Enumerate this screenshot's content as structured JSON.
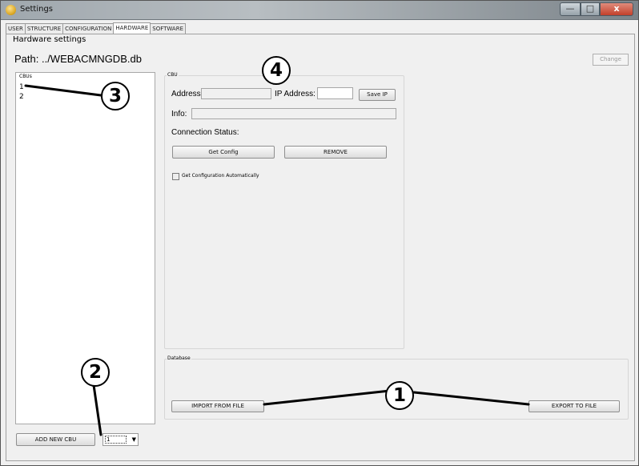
{
  "window": {
    "title": "Settings",
    "close_glyph": "x",
    "minimize_glyph": "—",
    "maximize_glyph": "□"
  },
  "tabs": [
    {
      "label": "USER"
    },
    {
      "label": "STRUCTURE"
    },
    {
      "label": "CONFIGURATION"
    },
    {
      "label": "HARDWARE",
      "active": true
    },
    {
      "label": "SOFTWARE"
    }
  ],
  "hardware": {
    "section_title": "Hardware settings",
    "path_label": "Path:  ../WEBACMNGDB.db",
    "change_label": "Change"
  },
  "cbu_list": {
    "header": "CBUs",
    "items": [
      "1",
      "2"
    ]
  },
  "cbu_panel": {
    "group_title": "CBU",
    "address_label": "Address:",
    "address_value": "",
    "ip_label": "IP Address:",
    "ip_value": "",
    "save_ip_label": "Save IP",
    "info_label": "Info:",
    "info_value": "",
    "connection_status_label": "Connection Status:",
    "get_config_label": "Get Config",
    "remove_label": "REMOVE",
    "auto_config_label": "Get Configuration Automatically",
    "auto_config_checked": false
  },
  "database": {
    "group_title": "Database",
    "import_label": "IMPORT FROM FILE",
    "export_label": "EXPORT TO FILE"
  },
  "bottom": {
    "add_new_cbu_label": "ADD NEW CBU",
    "cbu_count_value": "1",
    "dropdown_glyph": "▼"
  },
  "annotations": [
    "1",
    "2",
    "3",
    "4"
  ],
  "colors": {
    "title_bar": "#9fa7ad",
    "close_button": "#c3402b",
    "panel_bg": "#f0f0f0"
  }
}
